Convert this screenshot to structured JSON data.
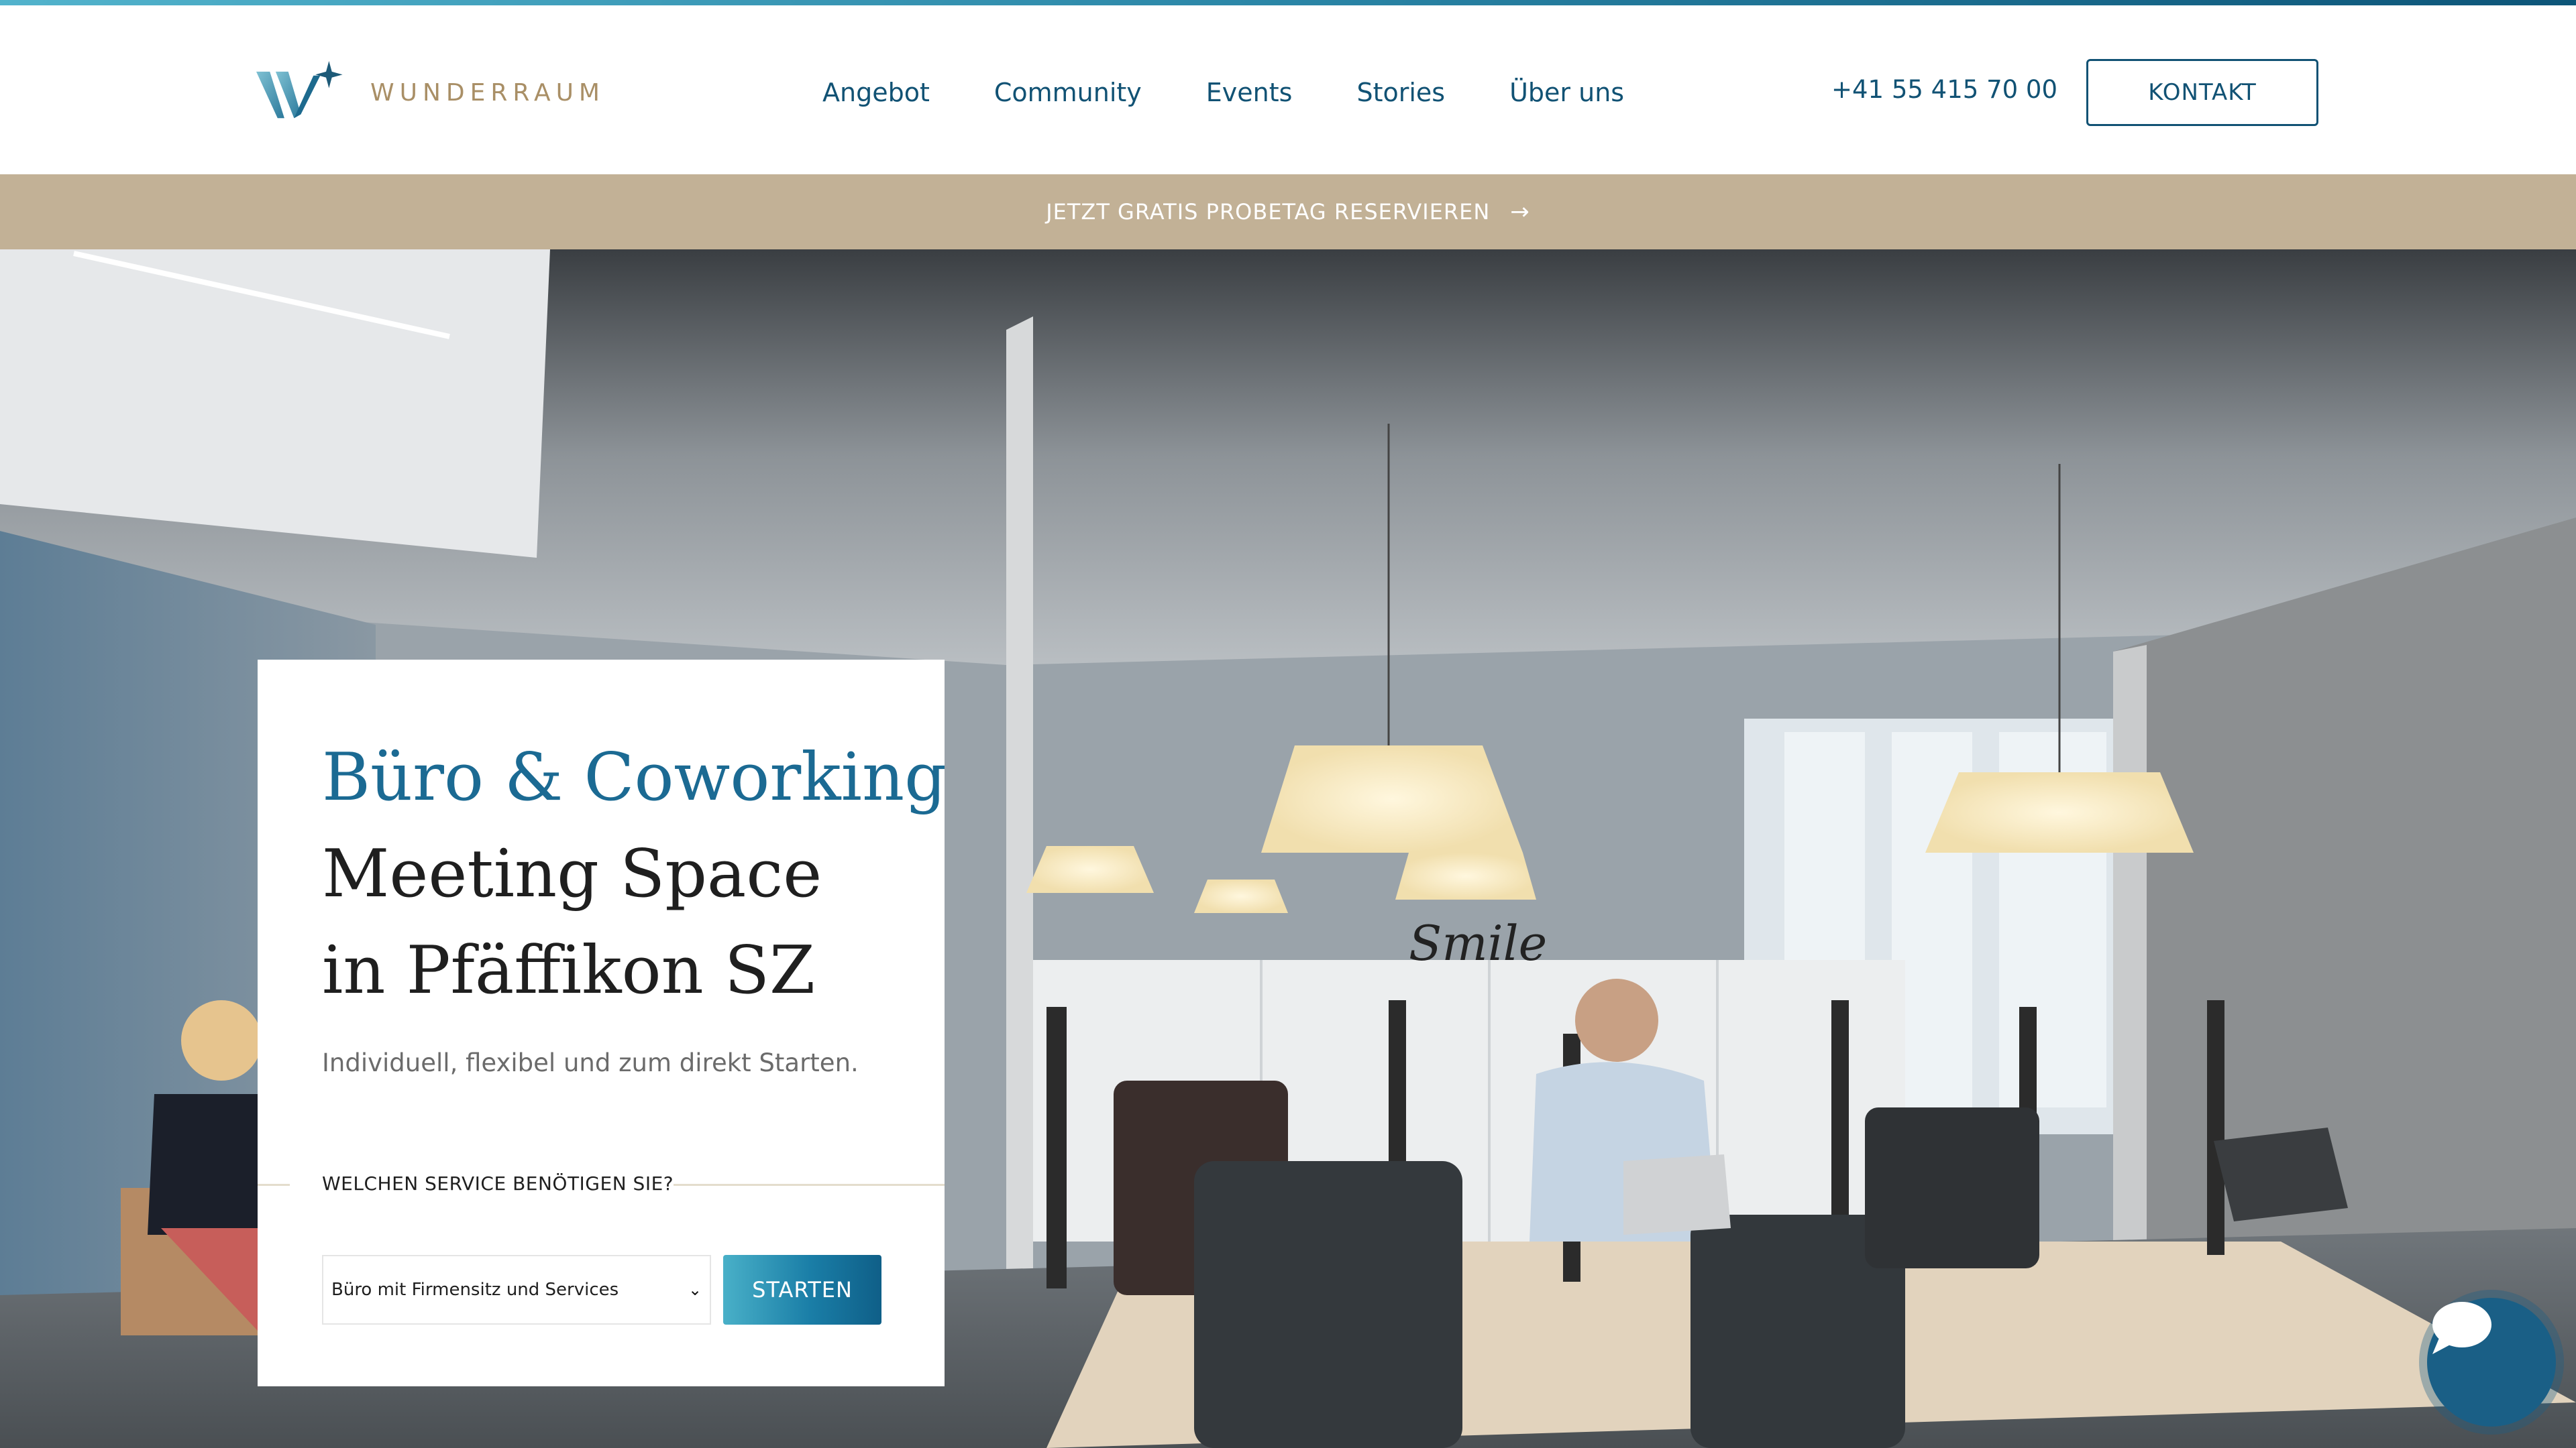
{
  "colors": {
    "brand_dark": "#115274",
    "brand_accent": "#1b6a93",
    "promo_bg": "#c2b196",
    "logo_text": "#a98f66"
  },
  "header": {
    "logo_text": "WUNDERRAUM",
    "nav": [
      {
        "label": "Angebot"
      },
      {
        "label": "Community"
      },
      {
        "label": "Events"
      },
      {
        "label": "Stories"
      },
      {
        "label": "Über uns"
      }
    ],
    "phone": "+41 55 415 70 00",
    "kontakt_label": "KONTAKT"
  },
  "promo": {
    "label": "JETZT GRATIS PROBETAG RESERVIEREN",
    "icon": "arrow-right-icon"
  },
  "hero": {
    "image_sign": "Smile",
    "card": {
      "title_line1": "Büro & Coworking",
      "title_line2": "Meeting Space",
      "title_line3": "in Pfäffikon SZ",
      "subtitle": "Individuell, flexibel und zum direkt Starten.",
      "service_label": "WELCHEN SERVICE BENÖTIGEN SIE?",
      "select_value": "Büro mit Firmensitz und Services",
      "button_label": "STARTEN"
    }
  },
  "chat": {
    "icon": "chat-bubble-icon"
  }
}
